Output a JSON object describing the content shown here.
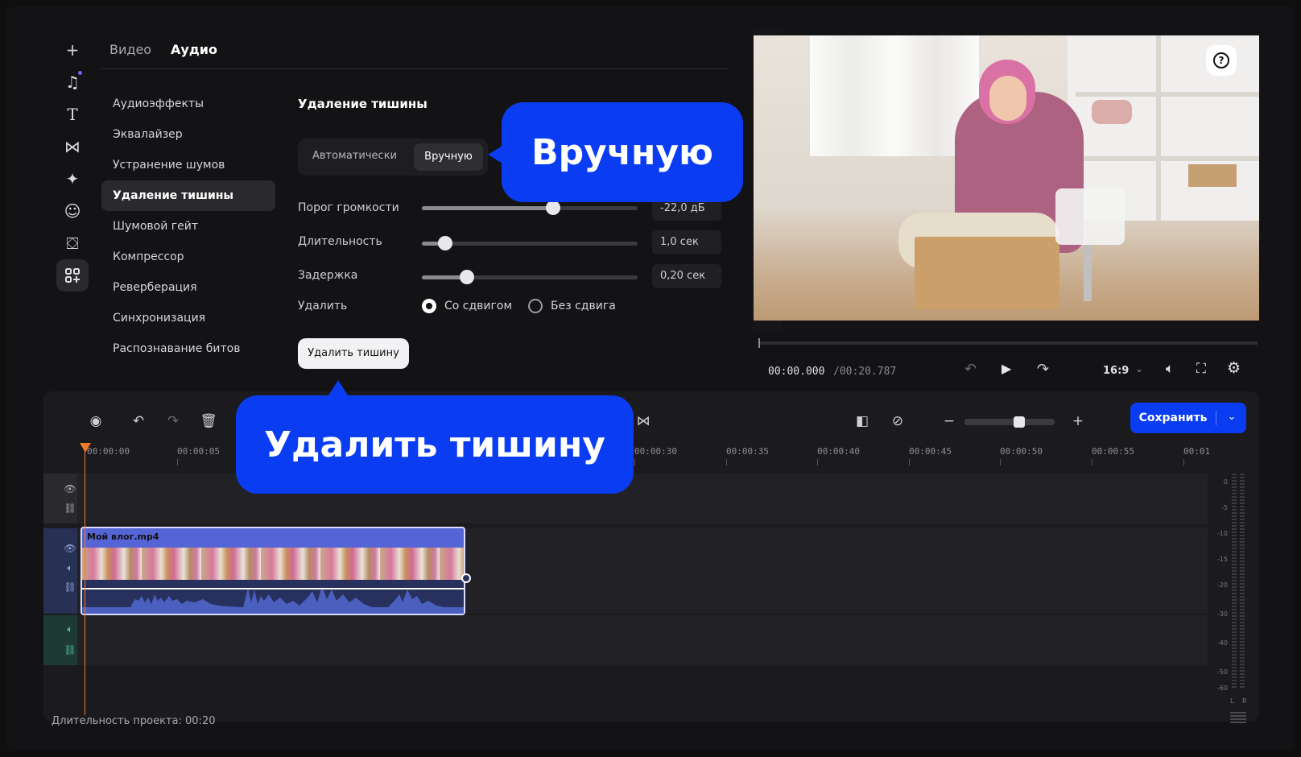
{
  "tabs": [
    {
      "label": "Видео"
    },
    {
      "label": "Аудио"
    }
  ],
  "audio_menu": {
    "items": [
      {
        "label": "Аудиоэффекты"
      },
      {
        "label": "Эквалайзер"
      },
      {
        "label": "Устранение шумов"
      },
      {
        "label": "Удаление тишины"
      },
      {
        "label": "Шумовой гейт"
      },
      {
        "label": "Компрессор"
      },
      {
        "label": "Реверберация"
      },
      {
        "label": "Синхронизация"
      },
      {
        "label": "Распознавание битов"
      }
    ],
    "active": "Удаление тишины"
  },
  "panel": {
    "title": "Удаление тишины",
    "mode_auto": "Автоматически",
    "mode_manual": "Вручную",
    "threshold": {
      "label": "Порог громкости",
      "value": "-22,0 дБ",
      "level": 0.61
    },
    "duration": {
      "label": "Длительность",
      "value": "1,0 сек",
      "level": 0.11
    },
    "delay": {
      "label": "Задержка",
      "value": "0,20 сек",
      "level": 0.21
    },
    "delete_label": "Удалить",
    "option_shift": "Со сдвигом",
    "option_noshift": "Без сдвига",
    "remove_button": "Удалить тишину"
  },
  "callouts": {
    "manual": "Вручную",
    "remove": "Удалить тишину"
  },
  "player": {
    "timecode_current": "00:00.000",
    "timecode_total": "/00:20.787",
    "aspect": "16:9",
    "progress": 0
  },
  "toolbar": {
    "save_label": "Сохранить",
    "zoom_level": 0.61
  },
  "timeline": {
    "ruler": [
      "00:00:00",
      "00:00:05",
      "00:00:30",
      "00:00:35",
      "00:00:40",
      "00:00:45",
      "00:00:50",
      "00:00:55",
      "00:01"
    ],
    "clip_name": "Мой влог.mp4",
    "db_scale": [
      "0",
      "-5",
      "-10",
      "-15",
      "-20",
      "-30",
      "-40",
      "-50",
      "-60"
    ],
    "channels": [
      "L",
      "R"
    ],
    "project_duration": "Длительность проекта: 00:20"
  },
  "colors": {
    "accent": "#0a3df2",
    "clip": "#5565d6",
    "playhead": "#f07a2a"
  }
}
